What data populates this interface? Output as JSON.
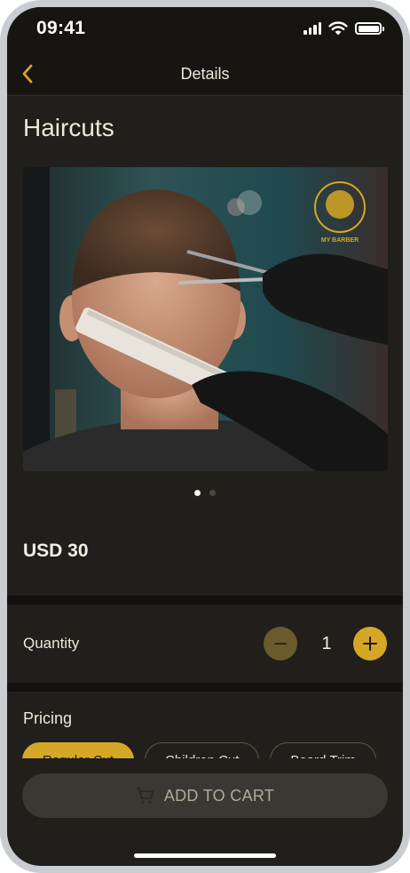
{
  "status_bar": {
    "time": "09:41"
  },
  "nav": {
    "title": "Details",
    "back_icon": "chevron-left-icon"
  },
  "page": {
    "title": "Haircuts"
  },
  "hero": {
    "image": "barber-haircut-photo",
    "logo_text": "MY BARBER",
    "carousel_pages": 2,
    "carousel_active": 1
  },
  "price": {
    "text": "USD 30"
  },
  "quantity": {
    "label": "Quantity",
    "value": "1",
    "minus_icon": "minus-icon",
    "plus_icon": "plus-icon"
  },
  "pricing": {
    "label": "Pricing",
    "options": [
      "Regular Cut",
      "Children Cut",
      "Beard Trim"
    ],
    "selected": "Regular Cut"
  },
  "cart": {
    "label": "ADD TO CART",
    "icon": "cart-icon"
  },
  "colors": {
    "accent": "#d6a726",
    "background": "#201f1b",
    "header": "#161512"
  }
}
